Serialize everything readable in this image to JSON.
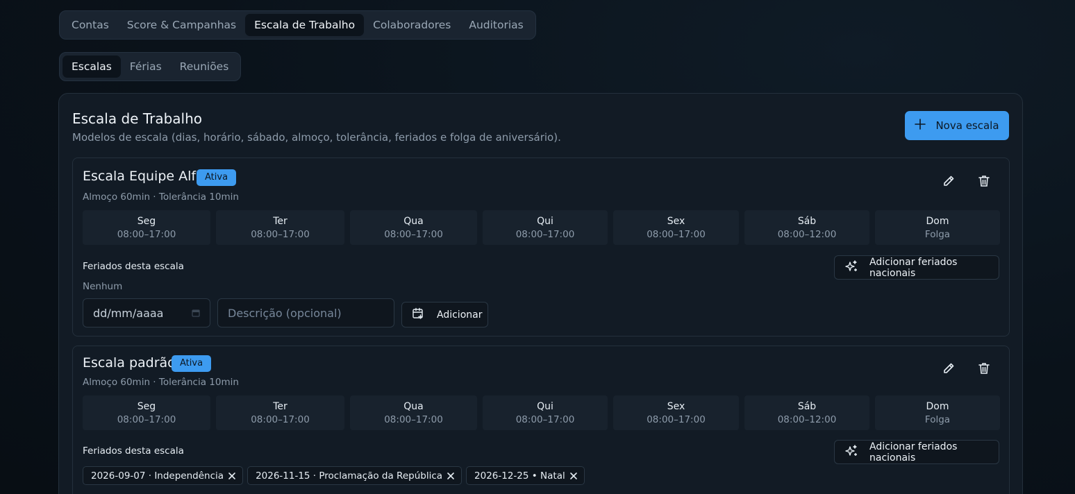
{
  "main_tabs": [
    "Contas",
    "Score & Campanhas",
    "Escala de Trabalho",
    "Colaboradores",
    "Auditorias"
  ],
  "main_tab_active": "Escala de Trabalho",
  "sub_tabs": [
    "Escalas",
    "Férias",
    "Reuniões"
  ],
  "sub_tab_active": "Escalas",
  "card": {
    "title": "Escala de Trabalho",
    "subtitle": "Modelos de escala (dias, horário, sábado, almoço, tolerância, feriados e folga de aniversário).",
    "new_button": "Nova escala"
  },
  "schedules": [
    {
      "name": "Escala Equipe Alfa",
      "status": "Ativa",
      "meta": "Almoço 60min · Tolerância 10min",
      "days": [
        {
          "name": "Seg",
          "hours": "08:00–17:00"
        },
        {
          "name": "Ter",
          "hours": "08:00–17:00"
        },
        {
          "name": "Qua",
          "hours": "08:00–17:00"
        },
        {
          "name": "Qui",
          "hours": "08:00–17:00"
        },
        {
          "name": "Sex",
          "hours": "08:00–17:00"
        },
        {
          "name": "Sáb",
          "hours": "08:00–12:00"
        },
        {
          "name": "Dom",
          "hours": "Folga"
        }
      ],
      "holidays_title": "Feriados desta escala",
      "holidays_empty": "Nenhum",
      "national_button": "Adicionar feriados nacionais",
      "date_placeholder": "dd/mm/aaaa",
      "desc_placeholder": "Descrição (opcional)",
      "add_button": "Adicionar"
    },
    {
      "name": "Escala padrão",
      "status": "Ativa",
      "meta": "Almoço 60min · Tolerância 10min",
      "days": [
        {
          "name": "Seg",
          "hours": "08:00–17:00"
        },
        {
          "name": "Ter",
          "hours": "08:00–17:00"
        },
        {
          "name": "Qua",
          "hours": "08:00–17:00"
        },
        {
          "name": "Qui",
          "hours": "08:00–17:00"
        },
        {
          "name": "Sex",
          "hours": "08:00–17:00"
        },
        {
          "name": "Sáb",
          "hours": "08:00–12:00"
        },
        {
          "name": "Dom",
          "hours": "Folga"
        }
      ],
      "holidays_title": "Feriados desta escala",
      "national_button": "Adicionar feriados nacionais",
      "holidays": [
        "2026-09-07 · Independência",
        "2026-11-15 · Proclamação da República",
        "2026-12-25 • Natal"
      ]
    }
  ],
  "colors": {
    "accent": "#3d9bf0",
    "background": "#0a121a",
    "card": "#121b25"
  }
}
